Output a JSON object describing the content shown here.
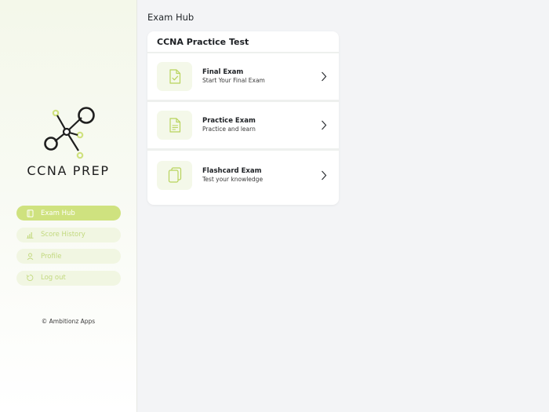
{
  "brand": {
    "name": "CCNA PREP",
    "accent": "#cfe27f",
    "accent_soft": "#f1f6e2",
    "accent_text": "#c2d97e",
    "logo_icon": "molecule-network-logo"
  },
  "sidebar": {
    "items": [
      {
        "label": "Exam Hub",
        "icon": "tablet-icon",
        "active": true
      },
      {
        "label": "Score History",
        "icon": "bar-chart-icon",
        "active": false
      },
      {
        "label": "Profile",
        "icon": "user-icon",
        "active": false
      },
      {
        "label": "Log out",
        "icon": "logout-icon",
        "active": false
      }
    ],
    "copyright": "© Ambitionz Apps"
  },
  "main": {
    "title": "Exam Hub",
    "card": {
      "title": "CCNA Practice Test",
      "exams": [
        {
          "title": "Final Exam",
          "subtitle": "Start Your Final Exam",
          "icon": "file-check-icon"
        },
        {
          "title": "Practice Exam",
          "subtitle": "Practice and learn",
          "icon": "file-text-icon"
        },
        {
          "title": "Flashcard Exam",
          "subtitle": "Test your knowledge",
          "icon": "copy-cards-icon"
        }
      ]
    }
  }
}
